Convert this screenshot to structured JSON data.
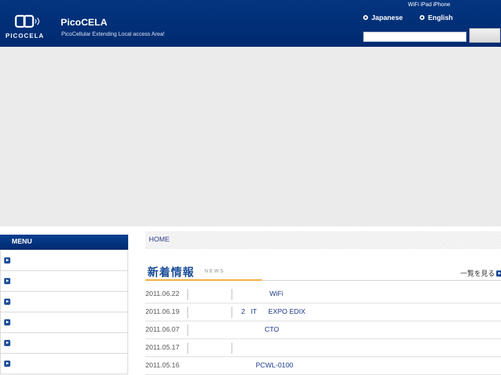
{
  "header": {
    "logo_text": "PICOCELA",
    "title": "PicoCELA",
    "tagline": "PicoCellular Extending Local access Area!",
    "top_note": "WiFi iPad iPhone",
    "languages": [
      {
        "label": "Japanese"
      },
      {
        "label": "English"
      }
    ],
    "search": {
      "placeholder": "",
      "button_label": ""
    }
  },
  "sidebar": {
    "menu_title": "MENU",
    "items": [
      {
        "label": ""
      },
      {
        "label": ""
      },
      {
        "label": ""
      },
      {
        "label": ""
      },
      {
        "label": ""
      },
      {
        "label": ""
      }
    ]
  },
  "breadcrumb": {
    "home": "HOME"
  },
  "news": {
    "title": "新着情報",
    "subtitle": "NEWS",
    "see_all": "一覧を見る",
    "items": [
      {
        "date": "2011.06.22",
        "text": "WiFi"
      },
      {
        "date": "2011.06.19",
        "text": "2   IT      EXPO EDIX"
      },
      {
        "date": "2011.06.07",
        "text": "CTO"
      },
      {
        "date": "2011.05.17",
        "text": ""
      },
      {
        "date": "2011.05.16",
        "text": "PCWL-0100"
      }
    ]
  },
  "colors": {
    "header_bg": "#002f7a",
    "accent": "#f0a830",
    "link": "#1c3a8a"
  }
}
